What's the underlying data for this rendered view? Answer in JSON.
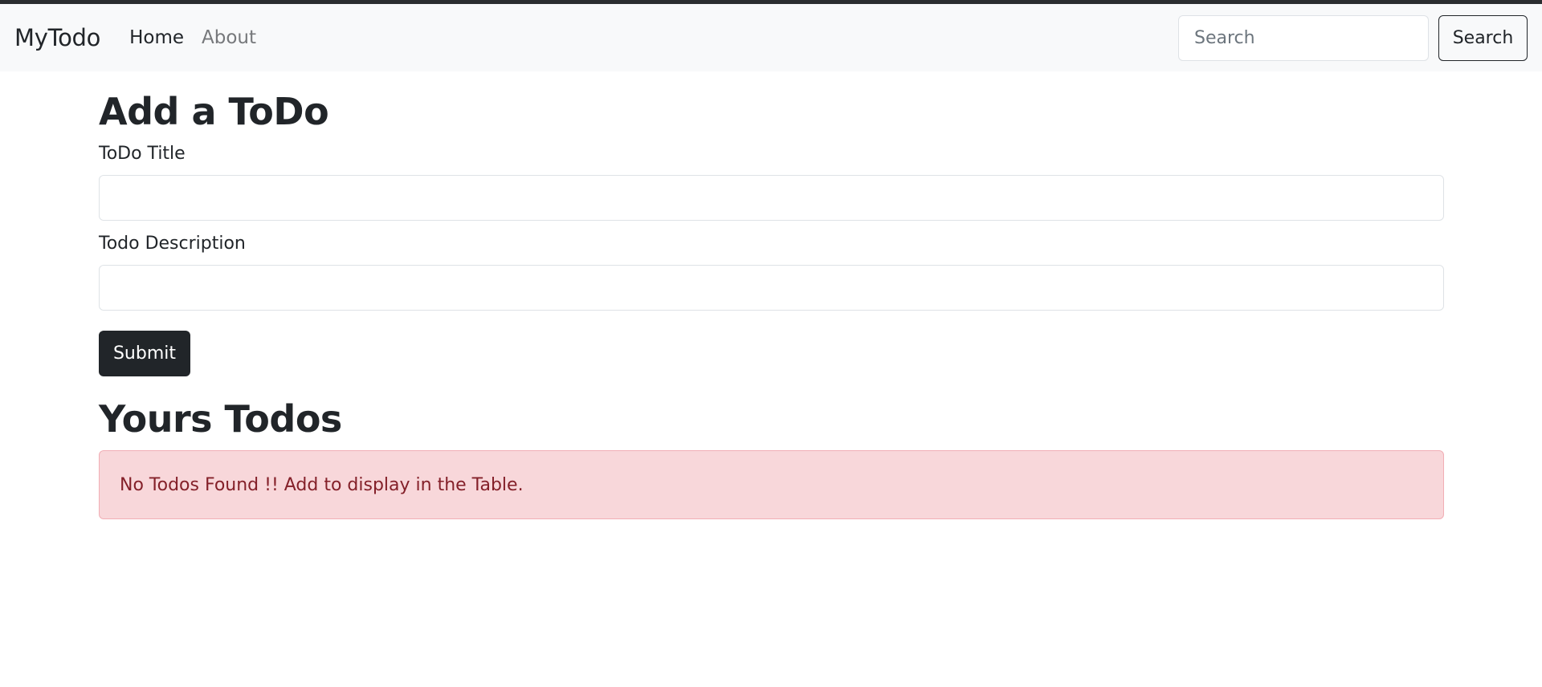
{
  "navbar": {
    "brand": "MyTodo",
    "links": [
      {
        "label": "Home"
      },
      {
        "label": "About"
      }
    ],
    "search": {
      "placeholder": "Search",
      "button_label": "Search"
    }
  },
  "form": {
    "heading": "Add a ToDo",
    "title_label": "ToDo Title",
    "title_value": "",
    "description_label": "Todo Description",
    "description_value": "",
    "submit_label": "Submit"
  },
  "todos": {
    "heading": "Yours Todos",
    "empty_message": "No Todos Found !! Add to display in the Table."
  },
  "colors": {
    "navbar_bg": "#f8f9fa",
    "dark_button": "#212529",
    "alert_bg": "#f8d7da",
    "alert_text": "#842029"
  }
}
